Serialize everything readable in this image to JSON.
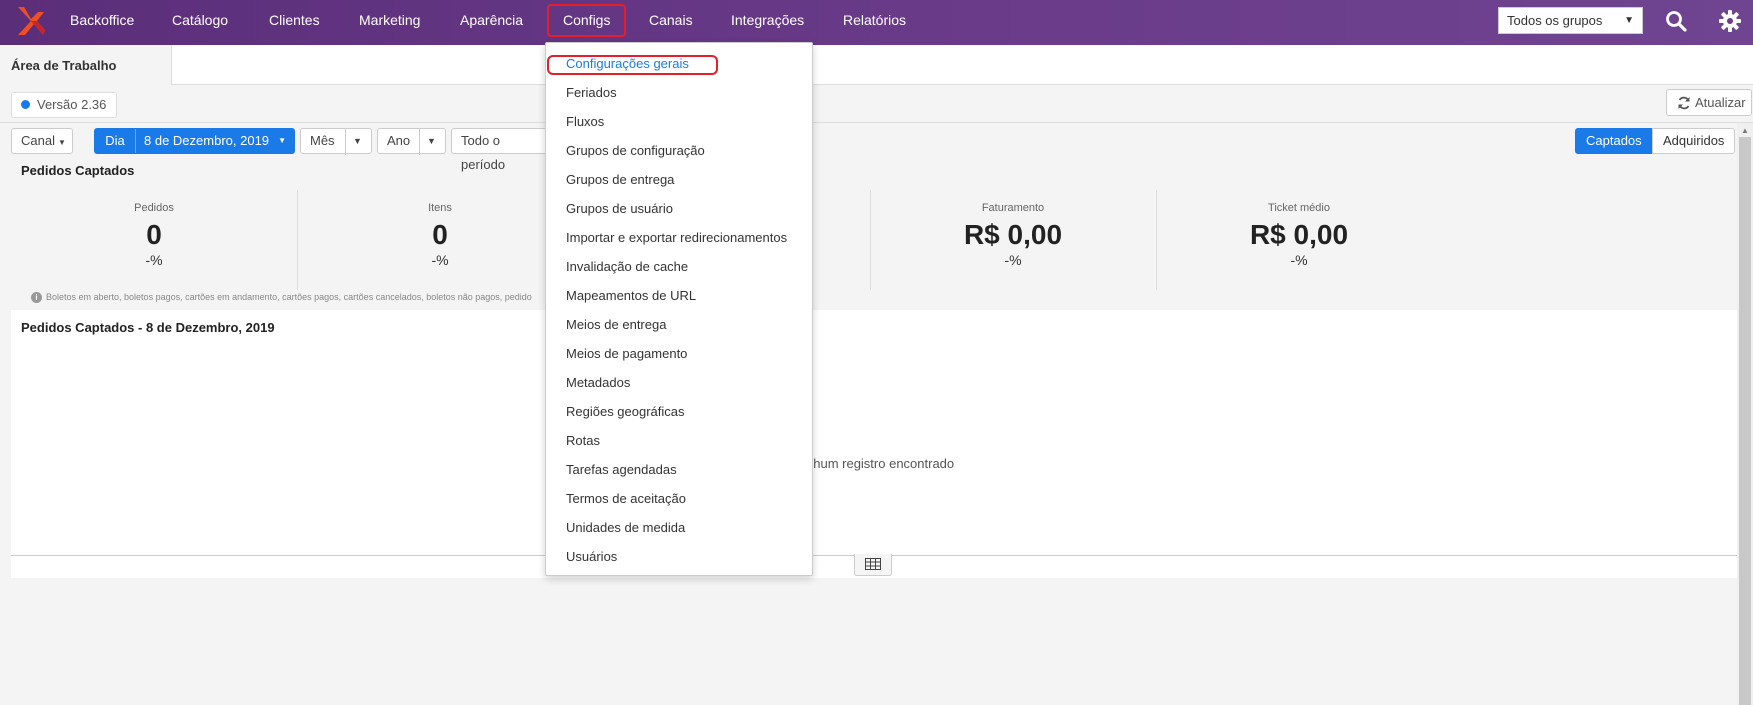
{
  "nav": {
    "items": [
      {
        "label": "Backoffice"
      },
      {
        "label": "Catálogo"
      },
      {
        "label": "Clientes"
      },
      {
        "label": "Marketing"
      },
      {
        "label": "Aparência"
      },
      {
        "label": "Configs",
        "active": true
      },
      {
        "label": "Canais"
      },
      {
        "label": "Integrações"
      },
      {
        "label": "Relatórios"
      }
    ],
    "group_select": "Todos os grupos",
    "search_icon": "search-icon",
    "settings_icon": "gear-icon"
  },
  "tabs": {
    "workspace": "Área de Trabalho"
  },
  "version": "Versão 2.36",
  "refresh": "Atualizar",
  "filters": {
    "canal": "Canal",
    "dia": "Dia",
    "date": "8 de Dezembro, 2019",
    "mes": "Mês",
    "ano": "Ano",
    "periodo": "Todo o período",
    "captados": "Captados",
    "adquiridos": "Adquiridos"
  },
  "summary": {
    "title": "Pedidos Captados",
    "kpis": [
      {
        "label": "Pedidos",
        "value": "0",
        "change": "-%"
      },
      {
        "label": "Itens",
        "value": "0",
        "change": "-%"
      },
      {
        "label": "Faturamento",
        "value": "R$ 0,00",
        "change": "-%"
      },
      {
        "label": "Ticket médio",
        "value": "R$ 0,00",
        "change": "-%"
      }
    ],
    "footnote": "Boletos em aberto, boletos pagos, cartões em andamento, cartões pagos, cartões cancelados, boletos não pagos, pedido"
  },
  "chart_section": {
    "title": "Pedidos Captados - 8 de Dezembro, 2019",
    "empty": "nhum registro encontrado"
  },
  "configs_menu": {
    "items": [
      "Configurações gerais",
      "Feriados",
      "Fluxos",
      "Grupos de configuração",
      "Grupos de entrega",
      "Grupos de usuário",
      "Importar e exportar redirecionamentos",
      "Invalidação de cache",
      "Mapeamentos de URL",
      "Meios de entrega",
      "Meios de pagamento",
      "Metadados",
      "Regiões geográficas",
      "Rotas",
      "Tarefas agendadas",
      "Termos de aceitação",
      "Unidades de medida",
      "Usuários"
    ],
    "highlighted_index": 0
  },
  "colors": {
    "nav_bg": "#5b2e7a",
    "accent": "#1a7be8",
    "highlight": "#e21f2b"
  }
}
